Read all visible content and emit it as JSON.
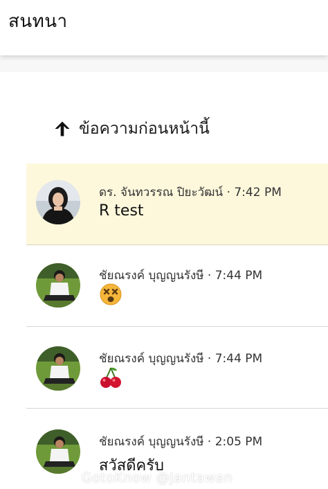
{
  "app_bar": {
    "title": "สนทนา"
  },
  "older_link": {
    "label": "ข้อความก่อนหน้านี้",
    "icon": "arrow-up-icon"
  },
  "messages": [
    {
      "sender": "ดร. จันทวรรณ ปิยะวัฒน์",
      "time": "7:42 PM",
      "text": "R test",
      "highlighted": true
    },
    {
      "sender": "ชัยณรงค์ บุญญนรังษี",
      "time": "7:44 PM",
      "emoji": "dizzy-face-emoji"
    },
    {
      "sender": "ชัยณรงค์ บุญญนรังษี",
      "time": "7:44 PM",
      "emoji": "cherries-emoji"
    },
    {
      "sender": "ชัยณรงค์ บุญญนรังษี",
      "time": "2:05 PM",
      "text": "สวัสดีครับ"
    }
  ],
  "separator": "·",
  "watermark": "GotoKnow @jantawan",
  "colors": {
    "highlight": "#fdf8dc",
    "divider": "#d6d6d6"
  }
}
